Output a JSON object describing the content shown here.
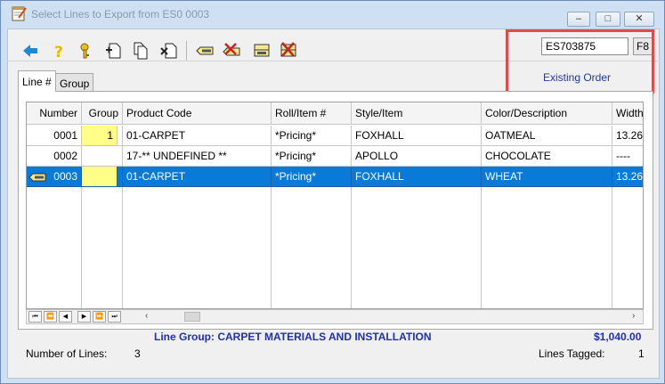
{
  "window": {
    "title": "Select Lines to Export from ES0 0003"
  },
  "order": {
    "number": "ES703875",
    "f8_label": "F8",
    "status": "Existing Order"
  },
  "tabs": [
    {
      "label": "Line #"
    },
    {
      "label": "Group"
    }
  ],
  "grid": {
    "columns": [
      "Number",
      "Group",
      "Product Code",
      "Roll/Item #",
      "Style/Item",
      "Color/Description",
      "Width"
    ],
    "rows": [
      {
        "number": "0001",
        "group": "1",
        "product_code": "01-CARPET",
        "roll_item": "*Pricing*",
        "style_item": "FOXHALL",
        "color_desc": "OATMEAL",
        "width": "13.26"
      },
      {
        "number": "0002",
        "group": "",
        "product_code": "17-** UNDEFINED **",
        "roll_item": "*Pricing*",
        "style_item": "APOLLO",
        "color_desc": "CHOCOLATE",
        "width": "----"
      },
      {
        "number": "0003",
        "group": "",
        "product_code": "01-CARPET",
        "roll_item": "*Pricing*",
        "style_item": "FOXHALL",
        "color_desc": "WHEAT",
        "width": "13.26"
      }
    ]
  },
  "footer": {
    "line_group": "Line Group: CARPET MATERIALS AND INSTALLATION",
    "total": "$1,040.00",
    "lines_label": "Number of Lines:",
    "lines_value": "3",
    "tagged_label": "Lines Tagged:",
    "tagged_value": "1"
  },
  "icons": {
    "toolbar": [
      "back-arrow-icon",
      "help-icon",
      "key-icon",
      "add-document-icon",
      "copy-documents-icon",
      "remove-document-icon",
      "tag-icon",
      "untag-icon",
      "tag-all-icon",
      "untag-all-icon"
    ]
  },
  "colors": {
    "selection": "#0a7ad8",
    "highlight_box": "#e04a4a",
    "link": "#1f3aa8",
    "group_cell": "#ffff88"
  }
}
